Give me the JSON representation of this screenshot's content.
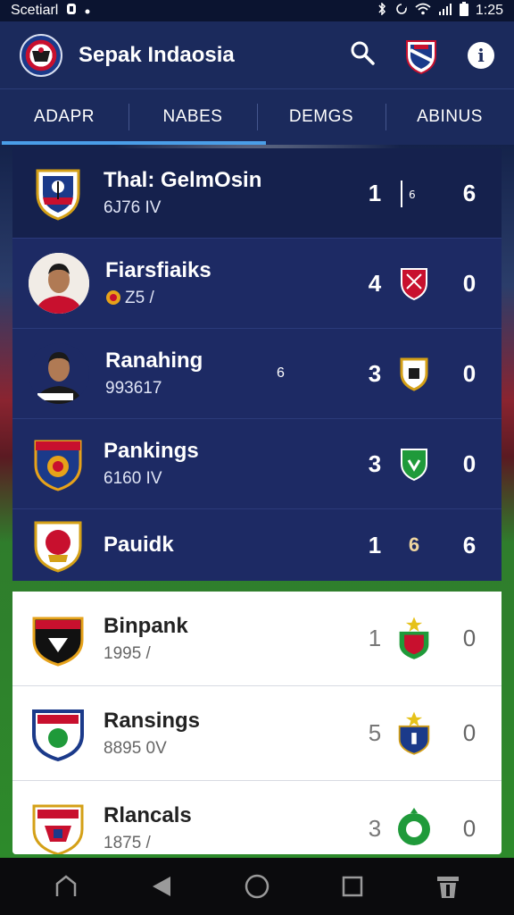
{
  "status": {
    "carrier": "Scetiarl",
    "time": "1:25"
  },
  "app": {
    "title": "Sepak Indaosia"
  },
  "tabs": [
    {
      "label": "ADAPR"
    },
    {
      "label": "NABES"
    },
    {
      "label": "DEMGS"
    },
    {
      "label": "ABINUS"
    }
  ],
  "rows": [
    {
      "name": "Thal: GelmOsin",
      "sub": "6J76 IV",
      "score_a": "1",
      "mid": "6",
      "score_b": "6",
      "kind": "crest"
    },
    {
      "name": "Fiarsfiaiks",
      "sub": "Z5 /",
      "score_a": "4",
      "score_b": "0",
      "kind": "player"
    },
    {
      "name": "Ranahing",
      "sub": "993617",
      "extra": "6",
      "score_a": "3",
      "score_b": "0",
      "kind": "player"
    },
    {
      "name": "Pankings",
      "sub": "6160 IV",
      "score_a": "3",
      "score_b": "0",
      "kind": "crest"
    },
    {
      "name": "Pauidk",
      "sub": "",
      "score_a": "1",
      "mid": "6",
      "score_b": "6",
      "kind": "crest"
    },
    {
      "name": "Binpank",
      "sub": "1995 /",
      "score_a": "1",
      "score_b": "0",
      "kind": "crest"
    },
    {
      "name": "Ransings",
      "sub": "8895 0V",
      "score_a": "5",
      "score_b": "0",
      "kind": "crest"
    },
    {
      "name": "Rlancals",
      "sub": "1875 /",
      "score_a": "3",
      "score_b": "0",
      "kind": "crest"
    }
  ],
  "colors": {
    "appbar": "#1b2a5c",
    "accent": "#4a9ee8",
    "dark_row": "#1d2a64",
    "light_row": "#ffffff"
  },
  "icons": {
    "search": "search-icon",
    "info": "info-icon",
    "home": "home-icon",
    "back": "back-icon",
    "circle": "home-circle-icon",
    "square": "recents-icon",
    "trash": "trash-icon"
  }
}
